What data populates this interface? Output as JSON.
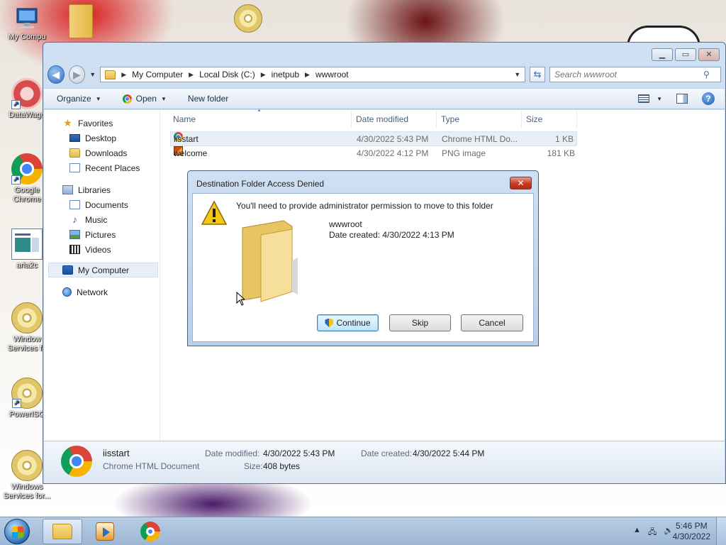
{
  "desktop": {
    "icons": [
      {
        "label": "My Compu",
        "icon": "computer-icon"
      },
      {
        "label": "",
        "icon": "folder-icon"
      },
      {
        "label": "",
        "icon": "cd-icon"
      },
      {
        "label": "DataWago",
        "icon": "datawago-icon"
      },
      {
        "label": "Google Chrome",
        "icon": "chrome-icon"
      },
      {
        "label": "aria2c",
        "icon": "aria2c-icon"
      },
      {
        "label": "Window Services fo",
        "icon": "cd-icon"
      },
      {
        "label": "PowerISO",
        "icon": "cd-icon"
      },
      {
        "label": "Windows Services for...",
        "icon": "cd-icon"
      }
    ]
  },
  "explorer": {
    "breadcrumb": [
      "My Computer",
      "Local Disk (C:)",
      "inetpub",
      "wwwroot"
    ],
    "search_placeholder": "Search wwwroot",
    "toolbar": {
      "organize": "Organize",
      "open": "Open",
      "new_folder": "New folder"
    },
    "nav": {
      "favorites": "Favorites",
      "favorites_items": [
        "Desktop",
        "Downloads",
        "Recent Places"
      ],
      "libraries": "Libraries",
      "libraries_items": [
        "Documents",
        "Music",
        "Pictures",
        "Videos"
      ],
      "computer": "My Computer",
      "network": "Network"
    },
    "columns": {
      "name": "Name",
      "date": "Date modified",
      "type": "Type",
      "size": "Size"
    },
    "files": [
      {
        "name": "iisstart",
        "date": "4/30/2022 5:43 PM",
        "type": "Chrome HTML Do...",
        "size": "1 KB",
        "icon": "chrome-icon"
      },
      {
        "name": "welcome",
        "date": "4/30/2022 4:12 PM",
        "type": "PNG image",
        "size": "181 KB",
        "icon": "png-icon"
      }
    ],
    "details": {
      "name": "iisstart",
      "type": "Chrome HTML Document",
      "modified_label": "Date modified:",
      "modified": "4/30/2022 5:43 PM",
      "created_label": "Date created:",
      "created": "4/30/2022 5:44 PM",
      "size_label": "Size:",
      "size": "408 bytes"
    }
  },
  "dialog": {
    "title": "Destination Folder Access Denied",
    "message": "You'll need to provide administrator permission to move to this folder",
    "folder_name": "wwwroot",
    "date_created": "Date created: 4/30/2022 4:13 PM",
    "continue": "Continue",
    "skip": "Skip",
    "cancel": "Cancel"
  },
  "taskbar": {
    "time": "5:46 PM",
    "date": "4/30/2022"
  },
  "colors": {
    "accent": "#2f6fc0",
    "window_frame": "#bed3ec",
    "close_red": "#c63a26"
  }
}
